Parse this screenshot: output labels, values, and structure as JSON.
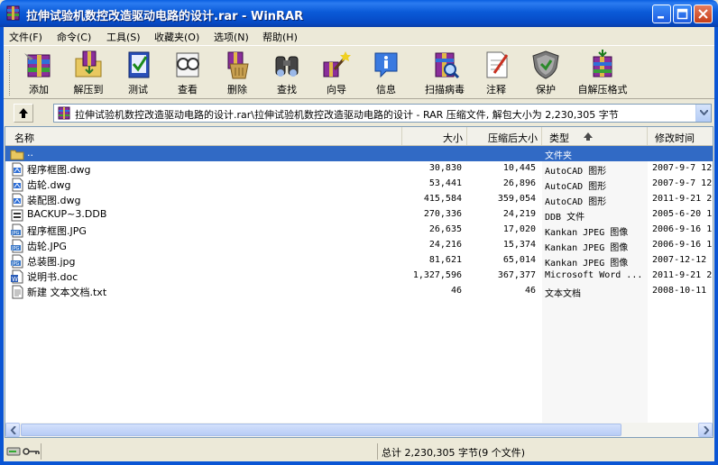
{
  "window": {
    "title": "拉伸试验机数控改造驱动电路的设计.rar - WinRAR"
  },
  "menubar": [
    {
      "label": "文件(F)"
    },
    {
      "label": "命令(C)"
    },
    {
      "label": "工具(S)"
    },
    {
      "label": "收藏夹(O)"
    },
    {
      "label": "选项(N)"
    },
    {
      "label": "帮助(H)"
    }
  ],
  "toolbar": [
    {
      "label": "添加",
      "icon": "add-archive-icon"
    },
    {
      "label": "解压到",
      "icon": "extract-to-icon"
    },
    {
      "label": "测试",
      "icon": "test-icon"
    },
    {
      "label": "查看",
      "icon": "view-icon"
    },
    {
      "label": "删除",
      "icon": "delete-icon"
    },
    {
      "label": "查找",
      "icon": "find-icon"
    },
    {
      "label": "向导",
      "icon": "wizard-icon"
    },
    {
      "label": "信息",
      "icon": "info-icon"
    },
    {
      "label": "扫描病毒",
      "icon": "virus-scan-icon"
    },
    {
      "label": "注释",
      "icon": "comment-icon"
    },
    {
      "label": "保护",
      "icon": "protect-icon"
    },
    {
      "label": "自解压格式",
      "icon": "sfx-icon"
    }
  ],
  "address": {
    "path": "拉伸试验机数控改造驱动电路的设计.rar\\拉伸试验机数控改造驱动电路的设计 - RAR 压缩文件, 解包大小为 2,230,305 字节"
  },
  "columns": {
    "name": "名称",
    "size": "大小",
    "packed": "压缩后大小",
    "type": "类型",
    "modified": "修改时间"
  },
  "files": [
    {
      "name": "..",
      "size": "",
      "packed": "",
      "type": "文件夹",
      "modified": "",
      "icon": "parent-folder-icon",
      "selected": true
    },
    {
      "name": "程序框图.dwg",
      "size": "30,830",
      "packed": "10,445",
      "type": "AutoCAD 图形",
      "modified": "2007-9-7 12",
      "icon": "dwg-file-icon"
    },
    {
      "name": "齿轮.dwg",
      "size": "53,441",
      "packed": "26,896",
      "type": "AutoCAD 图形",
      "modified": "2007-9-7 12",
      "icon": "dwg-file-icon"
    },
    {
      "name": "装配图.dwg",
      "size": "415,584",
      "packed": "359,054",
      "type": "AutoCAD 图形",
      "modified": "2011-9-21 2",
      "icon": "dwg-file-icon"
    },
    {
      "name": "BACKUP~3.DDB",
      "size": "270,336",
      "packed": "24,219",
      "type": "DDB 文件",
      "modified": "2005-6-20 1",
      "icon": "ddb-file-icon"
    },
    {
      "name": "程序框图.JPG",
      "size": "26,635",
      "packed": "17,020",
      "type": "Kankan JPEG 图像",
      "modified": "2006-9-16 1",
      "icon": "jpg-file-icon"
    },
    {
      "name": "齿轮.JPG",
      "size": "24,216",
      "packed": "15,374",
      "type": "Kankan JPEG 图像",
      "modified": "2006-9-16 1",
      "icon": "jpg-file-icon"
    },
    {
      "name": "总装图.jpg",
      "size": "81,621",
      "packed": "65,014",
      "type": "Kankan JPEG 图像",
      "modified": "2007-12-12",
      "icon": "jpg-file-icon"
    },
    {
      "name": "说明书.doc",
      "size": "1,327,596",
      "packed": "367,377",
      "type": "Microsoft Word ...",
      "modified": "2011-9-21 2",
      "icon": "doc-file-icon"
    },
    {
      "name": "新建 文本文档.txt",
      "size": "46",
      "packed": "46",
      "type": "文本文档",
      "modified": "2008-10-11",
      "icon": "txt-file-icon"
    }
  ],
  "status": {
    "total": "总计 2,230,305 字节(9 个文件)"
  },
  "colors": {
    "titlebar": "#0A5AD8",
    "selection": "#316AC5",
    "chrome": "#ECE9D8"
  }
}
